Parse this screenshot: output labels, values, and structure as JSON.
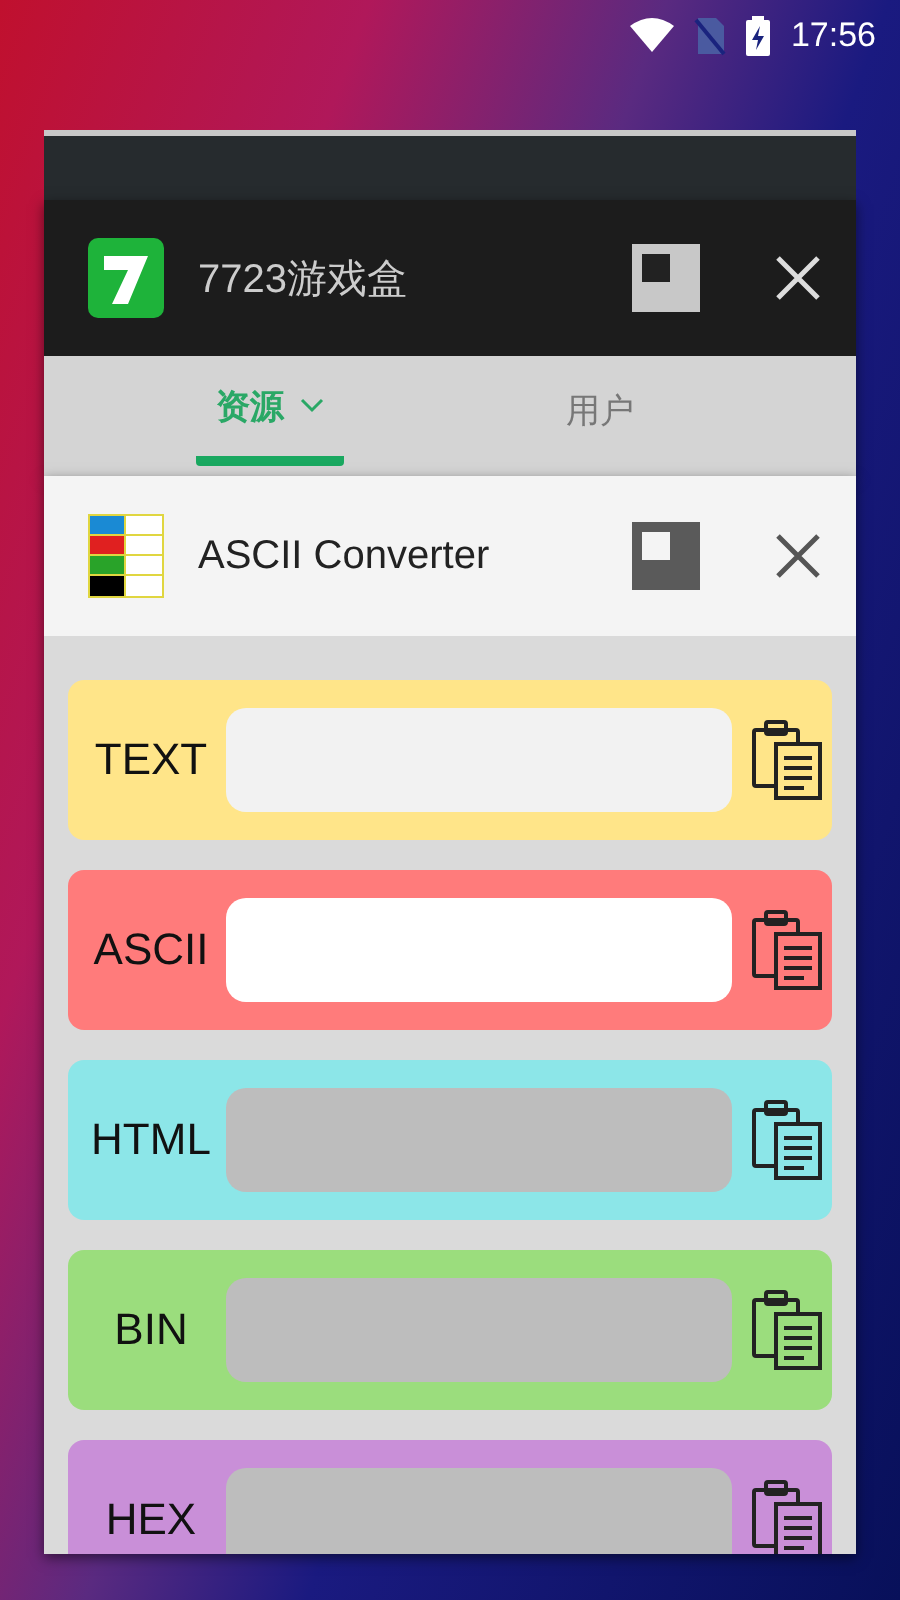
{
  "status_bar": {
    "time": "17:56"
  },
  "recent_apps": [
    {
      "kind": "hidden"
    },
    {
      "kind": "dark",
      "title": "7723游戏盒",
      "tabs": [
        {
          "label": "资源",
          "selected": true,
          "dropdown": true
        },
        {
          "label": "用户",
          "selected": false,
          "dropdown": false
        }
      ]
    },
    {
      "kind": "light",
      "title": "ASCII Converter",
      "rows": [
        {
          "label": "TEXT",
          "color": "#ffe589",
          "disabled": false,
          "focused": false
        },
        {
          "label": "ASCII",
          "color": "#ff7b7b",
          "disabled": false,
          "focused": true
        },
        {
          "label": "HTML",
          "color": "#8ce6e8",
          "disabled": true,
          "focused": false
        },
        {
          "label": "BIN",
          "color": "#9bdd7d",
          "disabled": true,
          "focused": false
        },
        {
          "label": "HEX",
          "color": "#c98fd8",
          "disabled": true,
          "focused": false
        }
      ]
    }
  ]
}
